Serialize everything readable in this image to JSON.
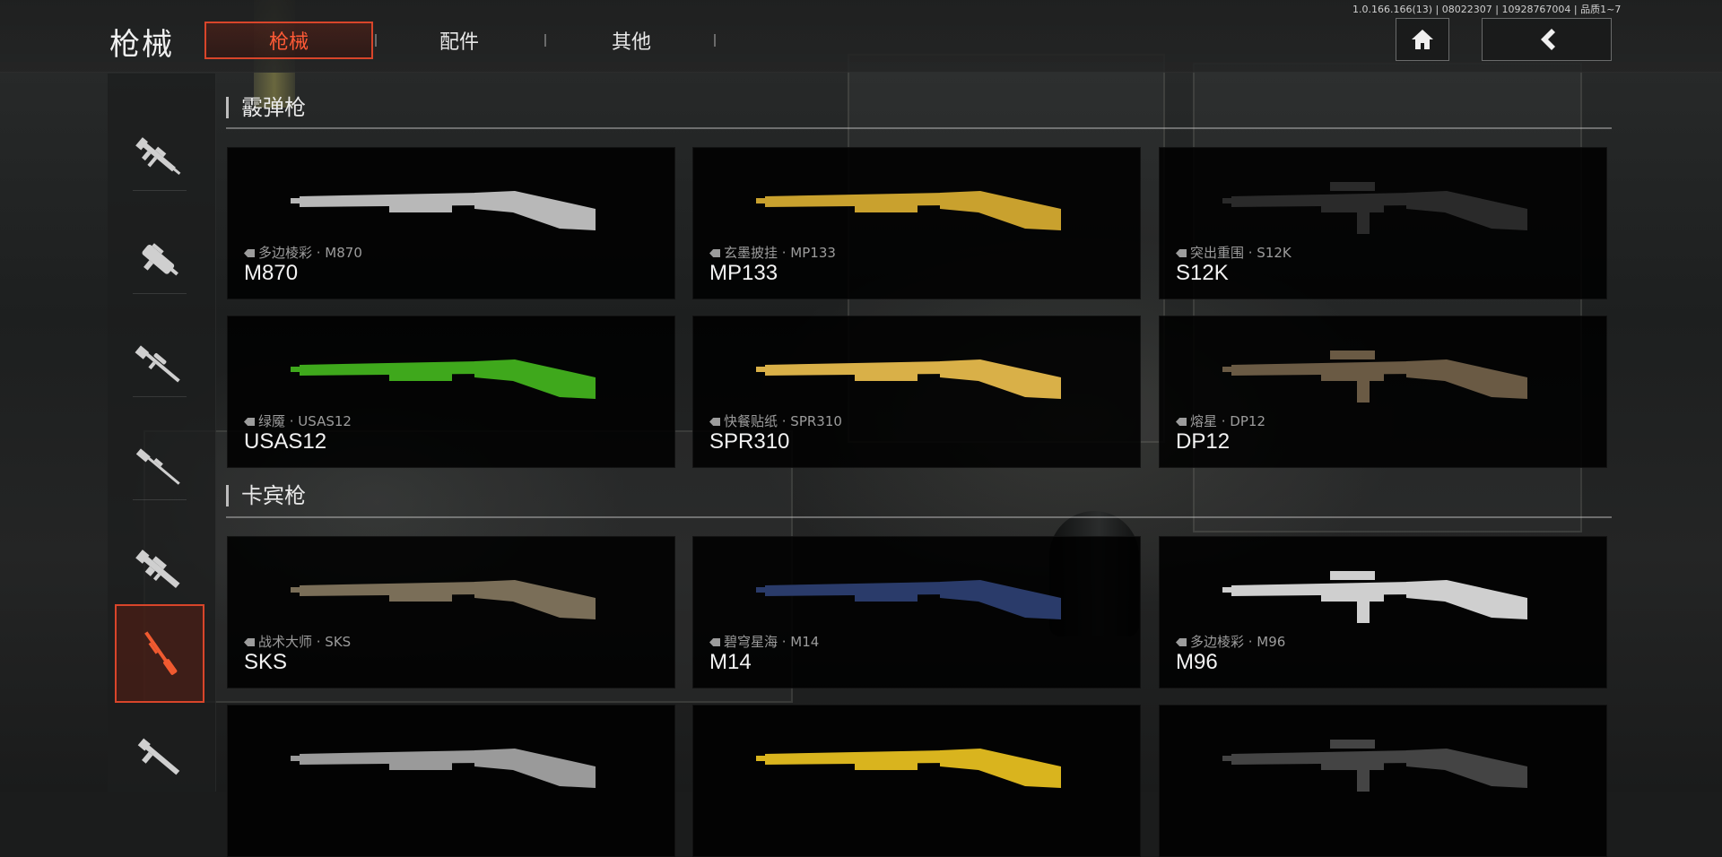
{
  "header": {
    "title": "枪械",
    "tabs": [
      {
        "label": "枪械",
        "active": true
      },
      {
        "label": "配件",
        "active": false
      },
      {
        "label": "其他",
        "active": false
      }
    ],
    "version_info": "1.0.166.166(13) | 08022307 | 10928767004 | 品质1~7",
    "home_icon": "home-icon",
    "back_icon": "chevron-left-icon"
  },
  "sidebar": {
    "items": [
      {
        "icon": "assault-rifle-icon",
        "active": false
      },
      {
        "icon": "smg-icon",
        "active": false
      },
      {
        "icon": "sniper-rifle-icon",
        "active": false
      },
      {
        "icon": "marksman-rifle-icon",
        "active": false
      },
      {
        "icon": "machine-gun-icon",
        "active": false
      },
      {
        "icon": "shotgun-icon",
        "active": true
      },
      {
        "icon": "pistol-icon",
        "active": false
      }
    ]
  },
  "sections": [
    {
      "title": "霰弹枪",
      "weapons": [
        {
          "skin": "多边棱彩 · M870",
          "name": "M870",
          "color": "#b8b8b8"
        },
        {
          "skin": "玄墨披挂 · MP133",
          "name": "MP133",
          "color": "#c9a12e"
        },
        {
          "skin": "突出重围 · S12K",
          "name": "S12K",
          "color": "#2a2a2a"
        },
        {
          "skin": "绿魇 · USAS12",
          "name": "USAS12",
          "color": "#3fa81c"
        },
        {
          "skin": "快餐贴纸 · SPR310",
          "name": "SPR310",
          "color": "#d9b048"
        },
        {
          "skin": "熔星 · DP12",
          "name": "DP12",
          "color": "#6a5a44"
        }
      ]
    },
    {
      "title": "卡宾枪",
      "weapons": [
        {
          "skin": "战术大师 · SKS",
          "name": "SKS",
          "color": "#7a6e58"
        },
        {
          "skin": "碧穹星海 · M14",
          "name": "M14",
          "color": "#2a3b6a"
        },
        {
          "skin": "多边棱彩 · M96",
          "name": "M96",
          "color": "#cfcfcf"
        },
        {
          "skin": "",
          "name": "",
          "color": "#9a9a9a"
        },
        {
          "skin": "",
          "name": "",
          "color": "#d9b41e"
        },
        {
          "skin": "",
          "name": "",
          "color": "#444444"
        }
      ]
    }
  ]
}
